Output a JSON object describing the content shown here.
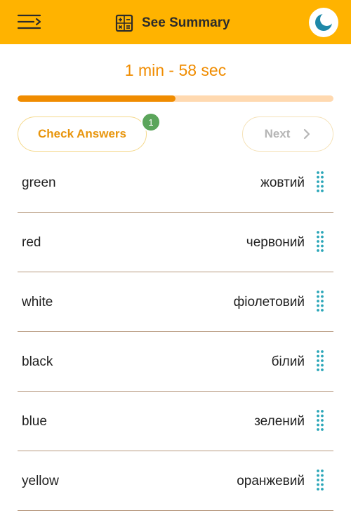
{
  "header": {
    "title": "See Summary",
    "menu_icon": "menu-icon",
    "summary_icon": "calculator-icon",
    "theme_icon": "moon-icon",
    "background_color": "#FFB300"
  },
  "timer": {
    "text": "1 min - 58 sec",
    "color": "#F08C00"
  },
  "progress": {
    "fraction": 0.5
  },
  "actions": {
    "check_label": "Check Answers",
    "badge_count": "1",
    "next_label": "Next"
  },
  "pairs": [
    {
      "english": "green",
      "ukrainian": "жовтий"
    },
    {
      "english": "red",
      "ukrainian": "червоний"
    },
    {
      "english": "white",
      "ukrainian": "фіолетовий"
    },
    {
      "english": "black",
      "ukrainian": "білий"
    },
    {
      "english": "blue",
      "ukrainian": "зелений"
    },
    {
      "english": "yellow",
      "ukrainian": "оранжевий"
    }
  ]
}
